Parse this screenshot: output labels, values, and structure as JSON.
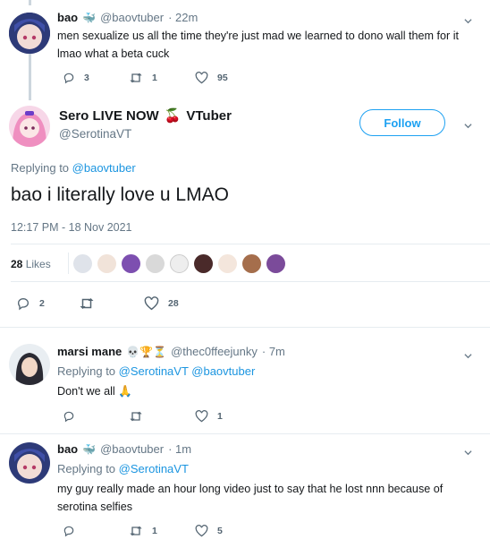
{
  "tweets": [
    {
      "name": "bao",
      "name_emoji": "🐳",
      "handle": "@baovtuber",
      "time": "· 22m",
      "text": "men sexualize us all the time they're just mad we learned to dono wall them for it lmao what a beta cuck",
      "replies": "3",
      "retweets": "1",
      "likes": "95"
    },
    {
      "name": "Sero LIVE NOW",
      "name_emoji": "🍒",
      "name_suffix": "VTuber",
      "handle": "@SerotinaVT",
      "follow_label": "Follow",
      "replying_prefix": "Replying to",
      "replying_to": "@baovtuber",
      "text": "bao i literally love u LMAO",
      "timestamp": "12:17 PM - 18 Nov 2021",
      "likes_count": "28",
      "likes_label": "Likes",
      "replies": "2",
      "retweets": "",
      "likes": "28"
    },
    {
      "name": "marsi mane",
      "name_emoji": "💀🏆⏳",
      "handle": "@thec0ffeejunky",
      "time": "· 7m",
      "replying_prefix": "Replying to",
      "replying_to": "@SerotinaVT @baovtuber",
      "text": "Don't we all 🙏",
      "replies": "",
      "retweets": "",
      "likes": "1"
    },
    {
      "name": "bao",
      "name_emoji": "🐳",
      "handle": "@baovtuber",
      "time": "· 1m",
      "replying_prefix": "Replying to",
      "replying_to": "@SerotinaVT",
      "text": "my guy really made an hour long video just to say that he lost nnn because of serotina selfies",
      "replies": "",
      "retweets": "1",
      "likes": "5"
    }
  ],
  "colors": {
    "link": "#1b95e0",
    "muted": "#657786",
    "border": "#e6ecf0",
    "follow": "#1da1f2"
  }
}
